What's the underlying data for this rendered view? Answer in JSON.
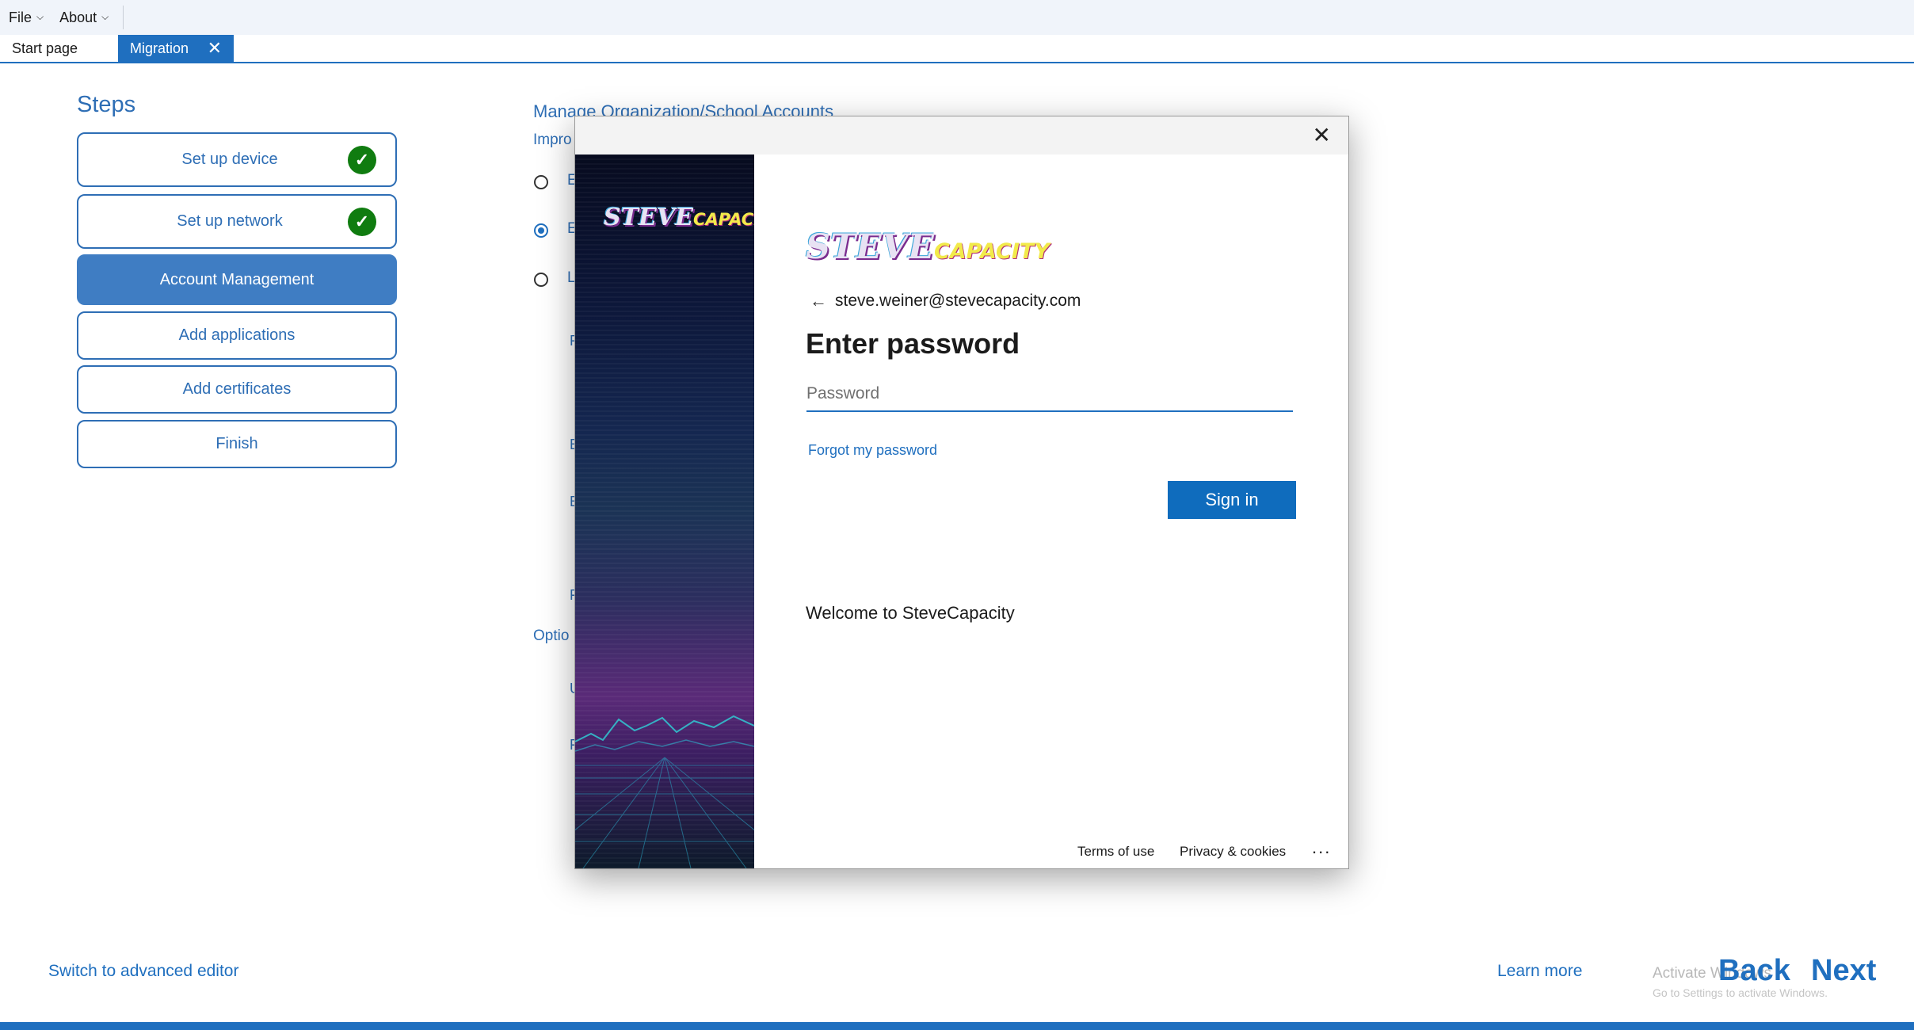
{
  "menu": {
    "file_label": "File",
    "about_label": "About"
  },
  "tabs": {
    "start_page": "Start page",
    "migration": "Migration",
    "close_glyph": "✕"
  },
  "steps": {
    "title": "Steps",
    "items": [
      {
        "label": "Set up device",
        "completed": true
      },
      {
        "label": "Set up network",
        "completed": true
      },
      {
        "label": "Account Management",
        "active": true
      },
      {
        "label": "Add applications"
      },
      {
        "label": "Add certificates"
      },
      {
        "label": "Finish"
      }
    ]
  },
  "main": {
    "heading": "Manage Organization/School Accounts",
    "subtext": "Impro",
    "radio_options": [
      {
        "label": "E",
        "selected": false
      },
      {
        "label": "E",
        "selected": true
      },
      {
        "label": "L",
        "selected": false
      }
    ],
    "fragments": [
      "F",
      "E",
      "E",
      "F",
      "U",
      "F"
    ],
    "options_heading": "Optio"
  },
  "dialog": {
    "close_glyph": "✕",
    "logo_steve": "STEVE",
    "logo_capacity": "CAPACITY",
    "email": "steve.weiner@stevecapacity.com",
    "back_glyph": "←",
    "heading": "Enter password",
    "password_placeholder": "Password",
    "forgot_label": "Forgot my password",
    "signin_label": "Sign in",
    "welcome_text": "Welcome to SteveCapacity",
    "terms_label": "Terms of use",
    "privacy_label": "Privacy & cookies",
    "more_label": "..."
  },
  "footer": {
    "switch_editor": "Switch to advanced editor",
    "learn_more": "Learn more",
    "activate_line1": "Activate Windows",
    "activate_line2": "Go to Settings to activate Windows.",
    "back_label": "Back",
    "next_label": "Next"
  },
  "colors": {
    "accent": "#1f6fbf",
    "step_active": "#3f7dc3",
    "check_green": "#107c10",
    "signin_blue": "#0f6cbd"
  }
}
